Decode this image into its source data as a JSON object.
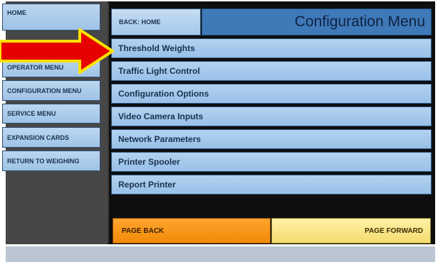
{
  "colors": {
    "menu_blue": "#a8cbee",
    "title_blue": "#4079b8",
    "page_back_orange": "#f28a06",
    "page_forward_yellow": "#f4dc6e",
    "arrow_red": "#e60000",
    "arrow_outline_yellow": "#ffe200"
  },
  "sidebar": {
    "items": [
      {
        "label": "HOME"
      },
      {
        "label": "OPERATOR MENU"
      },
      {
        "label": "CONFIGURATION MENU"
      },
      {
        "label": "SERVICE MENU"
      },
      {
        "label": "EXPANSION CARDS"
      },
      {
        "label": "RETURN TO WEIGHING"
      }
    ]
  },
  "header": {
    "back_label": "BACK: HOME",
    "title": "Configuration Menu"
  },
  "menu": {
    "items": [
      {
        "label": "Threshold Weights"
      },
      {
        "label": "Traffic Light Control"
      },
      {
        "label": "Configuration Options"
      },
      {
        "label": "Video Camera Inputs"
      },
      {
        "label": "Network Parameters"
      },
      {
        "label": "Printer Spooler"
      },
      {
        "label": "Report Printer"
      }
    ]
  },
  "paging": {
    "back_label": "PAGE BACK",
    "forward_label": "PAGE FORWARD"
  },
  "annotation": {
    "icon": "arrow-right-icon"
  }
}
